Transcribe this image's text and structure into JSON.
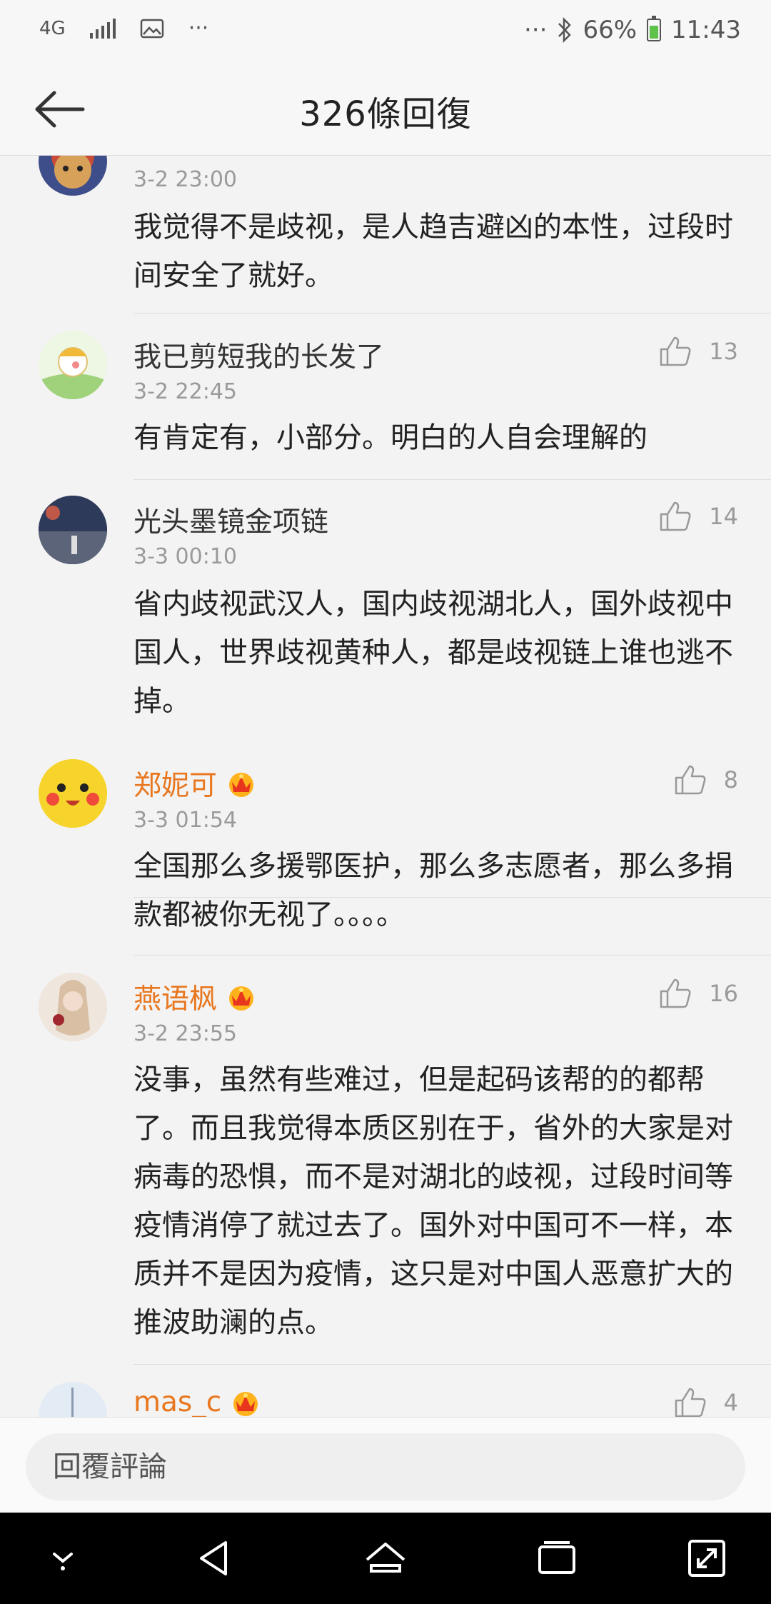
{
  "status_bar": {
    "network": "4G",
    "dots": "···",
    "right_dots": "···",
    "battery": "66%",
    "time": "11:43"
  },
  "header": {
    "title": "326條回復",
    "back_icon": "arrow-left-icon"
  },
  "comments": [
    {
      "time": "3-2 23:00",
      "text": "我觉得不是歧视，是人趋吉避凶的本性，过段时间安全了就好。"
    },
    {
      "name": "我已剪短我的长发了",
      "time": "3-2 22:45",
      "likes": "13",
      "text": "有肯定有，小部分。明白的人自会理解的"
    },
    {
      "name": "光头墨镜金项链",
      "time": "3-3 00:10",
      "likes": "14",
      "text": "省内歧视武汉人，国内歧视湖北人，国外歧视中国人，世界歧视黄种人，都是歧视链上谁也逃不掉。"
    },
    {
      "name": "郑妮可",
      "time": "3-3 01:54",
      "likes": "8",
      "text": "全国那么多援鄂医护，那么多志愿者，那么多捐款都被你无视了。。。。"
    },
    {
      "name": "燕语枫",
      "time": "3-2 23:55",
      "likes": "16",
      "text": "没事，虽然有些难过，但是起码该帮的的都帮了。而且我觉得本质区别在于，省外的大家是对病毒的恐惧，而不是对湖北的歧视，过段时间等疫情消停了就过去了。国外对中国可不一样，本质并不是因为疫情，这只是对中国人恶意扩大的推波助澜的点。"
    },
    {
      "name": "mas_c",
      "likes": "4"
    }
  ],
  "reply_bar": {
    "placeholder": "回覆評論"
  },
  "colors": {
    "vip_name": "#e8771f",
    "battery": "#5ec24b"
  }
}
